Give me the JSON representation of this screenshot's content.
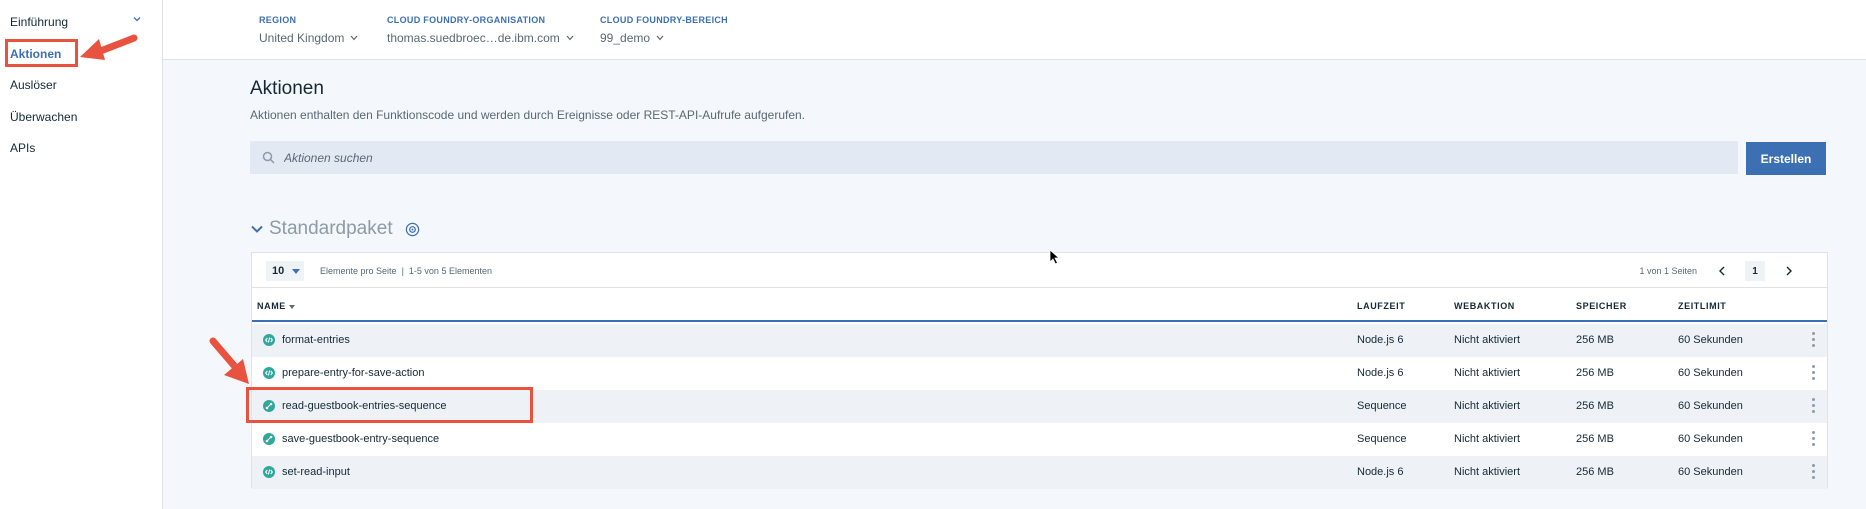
{
  "sidebar": {
    "items": [
      {
        "label": "Einführung",
        "active": false,
        "has_chevron": true
      },
      {
        "label": "Aktionen",
        "active": true
      },
      {
        "label": "Auslöser",
        "active": false
      },
      {
        "label": "Überwachen",
        "active": false
      },
      {
        "label": "APIs",
        "active": false
      }
    ]
  },
  "context": {
    "region": {
      "label": "REGION",
      "value": "United Kingdom"
    },
    "org": {
      "label": "CLOUD FOUNDRY-ORGANISATION",
      "value": "thomas.suedbroec…de.ibm.com"
    },
    "space": {
      "label": "CLOUD FOUNDRY-BEREICH",
      "value": "99_demo"
    }
  },
  "main": {
    "title": "Aktionen",
    "description": "Aktionen enthalten den Funktionscode und werden durch Ereignisse oder REST-API-Aufrufe aufgerufen.",
    "search_placeholder": "Aktionen suchen",
    "create_label": "Erstellen"
  },
  "package": {
    "title": "Standardpaket",
    "per_page": "10",
    "per_page_label": "Elemente pro Seite",
    "separator": "|",
    "range_label": "1-5 von 5 Elementen",
    "pages_label": "1 von 1 Seiten",
    "current_page": "1"
  },
  "table": {
    "columns": [
      "NAME",
      "LAUFZEIT",
      "WEBAKTION",
      "SPEICHER",
      "ZEITLIMIT"
    ],
    "rows": [
      {
        "name": "format-entries",
        "icon": "code-icon",
        "runtime": "Node.js 6",
        "web": "Nicht aktiviert",
        "memory": "256 MB",
        "timeout": "60 Sekunden"
      },
      {
        "name": "prepare-entry-for-save-action",
        "icon": "code-icon",
        "runtime": "Node.js 6",
        "web": "Nicht aktiviert",
        "memory": "256 MB",
        "timeout": "60 Sekunden"
      },
      {
        "name": "read-guestbook-entries-sequence",
        "icon": "sequence-icon",
        "runtime": "Sequence",
        "web": "Nicht aktiviert",
        "memory": "256 MB",
        "timeout": "60 Sekunden"
      },
      {
        "name": "save-guestbook-entry-sequence",
        "icon": "sequence-icon",
        "runtime": "Sequence",
        "web": "Nicht aktiviert",
        "memory": "256 MB",
        "timeout": "60 Sekunden"
      },
      {
        "name": "set-read-input",
        "icon": "code-icon",
        "runtime": "Node.js 6",
        "web": "Nicht aktiviert",
        "memory": "256 MB",
        "timeout": "60 Sekunden"
      }
    ]
  },
  "colors": {
    "accent": "#3d70b2",
    "annotation": "#e8523f",
    "icon_green": "#2fa89b"
  }
}
